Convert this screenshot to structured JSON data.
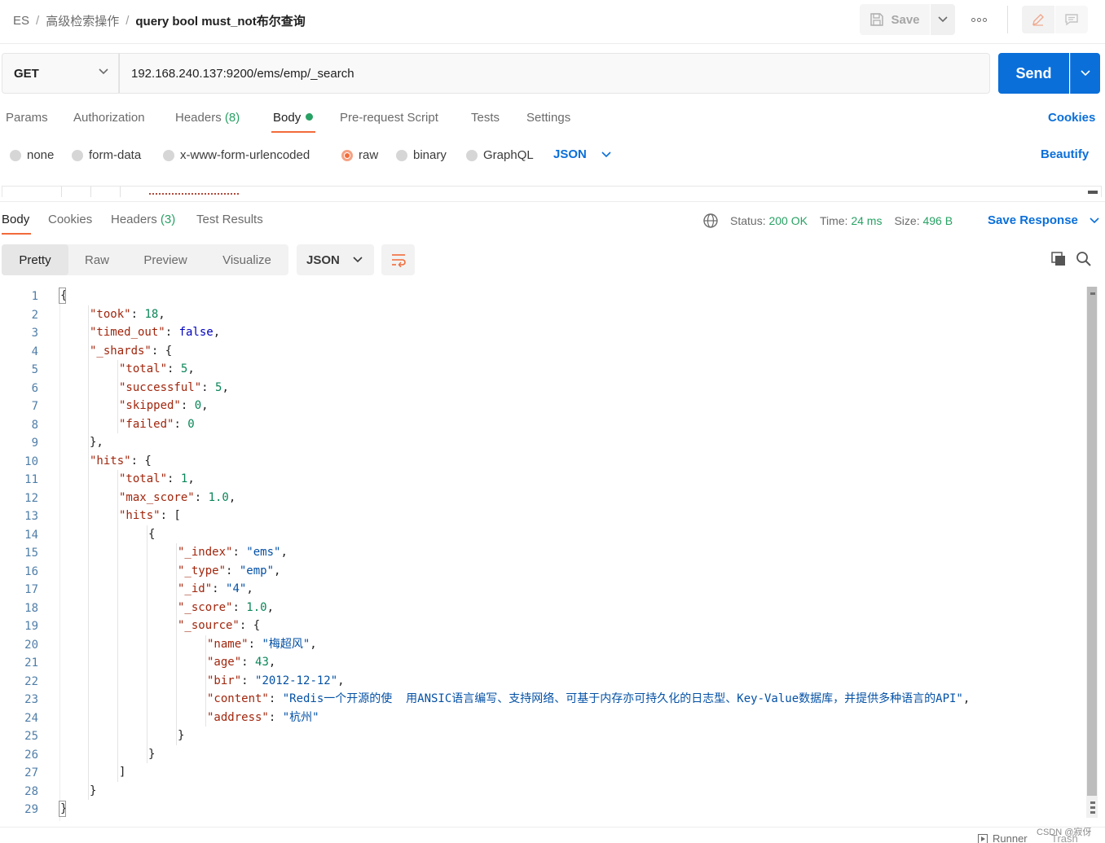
{
  "breadcrumb": {
    "workspace": "ES",
    "folder": "高级检索操作",
    "request": "query bool must_not布尔查询",
    "separator": "/"
  },
  "toolbar": {
    "save_label": "Save",
    "save_icon": "floppy-disk-icon",
    "more_icon": "more-horizontal-icon",
    "edit_icon": "pencil-icon",
    "comment_icon": "comment-icon"
  },
  "request": {
    "method": "GET",
    "url": "192.168.240.137:9200/ems/emp/_search",
    "send_label": "Send"
  },
  "request_tabs": {
    "params": "Params",
    "authorization": "Authorization",
    "headers": "Headers",
    "headers_count": "(8)",
    "body": "Body",
    "pre_request": "Pre-request Script",
    "tests": "Tests",
    "settings": "Settings",
    "cookies": "Cookies"
  },
  "body_types": {
    "none": "none",
    "form_data": "form-data",
    "urlencoded": "x-www-form-urlencoded",
    "raw": "raw",
    "binary": "binary",
    "graphql": "GraphQL",
    "selected_format": "JSON",
    "beautify": "Beautify"
  },
  "response_tabs": {
    "body": "Body",
    "cookies": "Cookies",
    "headers": "Headers",
    "headers_count": "(3)",
    "test_results": "Test Results"
  },
  "response_status": {
    "status_label": "Status:",
    "status_value": "200 OK",
    "time_label": "Time:",
    "time_value": "24 ms",
    "size_label": "Size:",
    "size_value": "496 B",
    "save_response": "Save Response"
  },
  "view_modes": {
    "pretty": "Pretty",
    "raw": "Raw",
    "preview": "Preview",
    "visualize": "Visualize",
    "format": "JSON"
  },
  "code_lines": [
    {
      "n": "1",
      "t": "{"
    },
    {
      "n": "2",
      "t": "    \"took\": 18,"
    },
    {
      "n": "3",
      "t": "    \"timed_out\": false,"
    },
    {
      "n": "4",
      "t": "    \"_shards\": {"
    },
    {
      "n": "5",
      "t": "        \"total\": 5,"
    },
    {
      "n": "6",
      "t": "        \"successful\": 5,"
    },
    {
      "n": "7",
      "t": "        \"skipped\": 0,"
    },
    {
      "n": "8",
      "t": "        \"failed\": 0"
    },
    {
      "n": "9",
      "t": "    },"
    },
    {
      "n": "10",
      "t": "    \"hits\": {"
    },
    {
      "n": "11",
      "t": "        \"total\": 1,"
    },
    {
      "n": "12",
      "t": "        \"max_score\": 1.0,"
    },
    {
      "n": "13",
      "t": "        \"hits\": ["
    },
    {
      "n": "14",
      "t": "            {"
    },
    {
      "n": "15",
      "t": "                \"_index\": \"ems\","
    },
    {
      "n": "16",
      "t": "                \"_type\": \"emp\","
    },
    {
      "n": "17",
      "t": "                \"_id\": \"4\","
    },
    {
      "n": "18",
      "t": "                \"_score\": 1.0,"
    },
    {
      "n": "19",
      "t": "                \"_source\": {"
    },
    {
      "n": "20",
      "t": "                    \"name\": \"梅超风\","
    },
    {
      "n": "21",
      "t": "                    \"age\": 43,"
    },
    {
      "n": "22",
      "t": "                    \"bir\": \"2012-12-12\","
    },
    {
      "n": "23",
      "t": "                    \"content\": \"Redis一个开源的使  用ANSIC语言编写、支持网络、可基于内存亦可持久化的日志型、Key-Value数据库，并提供多种语言的API\","
    },
    {
      "n": "24",
      "t": "                    \"address\": \"杭州\""
    },
    {
      "n": "25",
      "t": "                }"
    },
    {
      "n": "26",
      "t": "            }"
    },
    {
      "n": "27",
      "t": "        ]"
    },
    {
      "n": "28",
      "t": "    }"
    },
    {
      "n": "29",
      "t": "}"
    }
  ],
  "footer": {
    "runner": "Runner",
    "trash": "Trash",
    "watermark": "CSDN @寂伢"
  },
  "colors": {
    "accent_blue": "#0a6fd9",
    "tab_underline": "#f26b3a",
    "status_green": "#28a164"
  }
}
